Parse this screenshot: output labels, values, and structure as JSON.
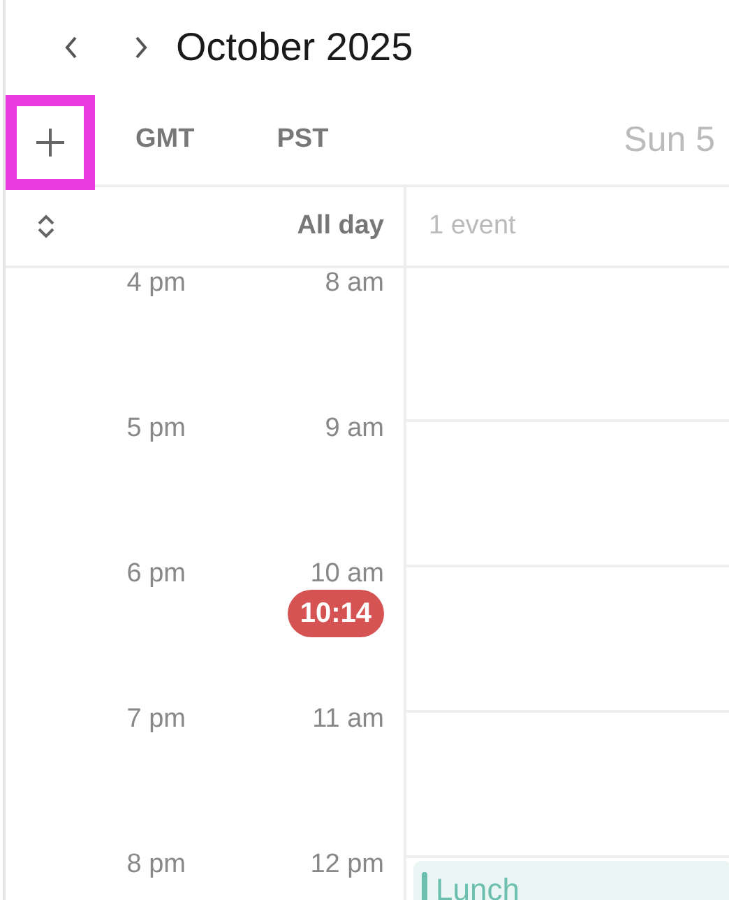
{
  "title": "October 2025",
  "timezones": [
    {
      "label": "GMT"
    },
    {
      "label": "PST"
    }
  ],
  "day_header": "Sun 5",
  "all_day": {
    "label": "All day",
    "summary": "1 event"
  },
  "hours": [
    {
      "gmt": "4 pm",
      "pst": "8 am"
    },
    {
      "gmt": "5 pm",
      "pst": "9 am"
    },
    {
      "gmt": "6 pm",
      "pst": "10 am",
      "now": "10:14"
    },
    {
      "gmt": "7 pm",
      "pst": "11 am"
    },
    {
      "gmt": "8 pm",
      "pst": "12 pm",
      "events": [
        {
          "title": "Lunch",
          "color": "#6cbfad"
        }
      ]
    }
  ]
}
